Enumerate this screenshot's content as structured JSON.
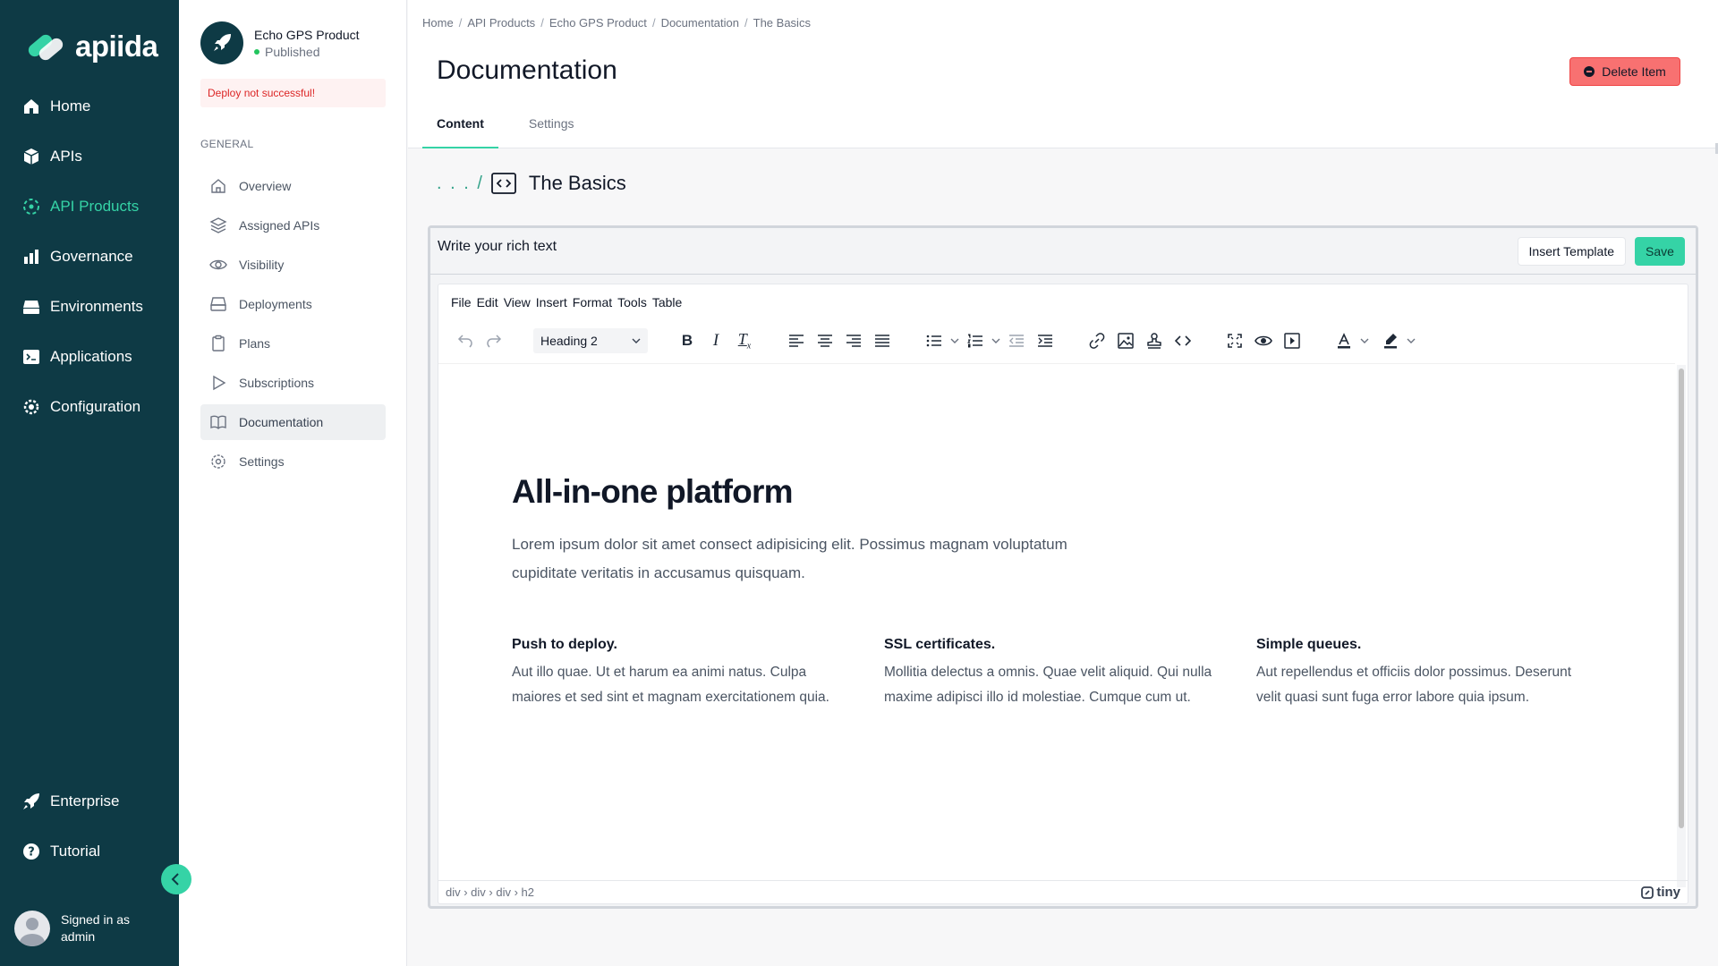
{
  "sidebar": {
    "brand": "apiida",
    "nav": [
      {
        "label": "Home",
        "icon": "home-icon"
      },
      {
        "label": "APIs",
        "icon": "cube-icon"
      },
      {
        "label": "API Products",
        "icon": "product-icon"
      },
      {
        "label": "Governance",
        "icon": "bar-chart-icon"
      },
      {
        "label": "Environments",
        "icon": "server-icon"
      },
      {
        "label": "Applications",
        "icon": "terminal-icon"
      },
      {
        "label": "Configuration",
        "icon": "gear-icon"
      }
    ],
    "bottom": [
      {
        "label": "Enterprise",
        "icon": "rocket-icon"
      },
      {
        "label": "Tutorial",
        "icon": "question-icon"
      }
    ],
    "user": {
      "line1": "Signed in as",
      "line2": "admin"
    },
    "accent": "#35d3a6",
    "background": "#0e3a45"
  },
  "product": {
    "name": "Echo GPS Product",
    "status": "Published",
    "alert": "Deploy not successful!"
  },
  "subnav": {
    "section": "GENERAL",
    "items": [
      {
        "label": "Overview",
        "icon": "home-outline-icon"
      },
      {
        "label": "Assigned APIs",
        "icon": "layers-icon"
      },
      {
        "label": "Visibility",
        "icon": "eye-icon"
      },
      {
        "label": "Deployments",
        "icon": "drive-icon"
      },
      {
        "label": "Plans",
        "icon": "clipboard-icon"
      },
      {
        "label": "Subscriptions",
        "icon": "play-icon"
      },
      {
        "label": "Documentation",
        "icon": "book-icon"
      },
      {
        "label": "Settings",
        "icon": "gear-outline-icon"
      }
    ]
  },
  "breadcrumb": [
    "Home",
    "API Products",
    "Echo GPS Product",
    "Documentation",
    "The Basics"
  ],
  "page": {
    "title": "Documentation",
    "delete_label": "Delete Item",
    "tabs": [
      "Content",
      "Settings"
    ],
    "path_prefix": ". . . /",
    "doc_title": "The Basics"
  },
  "editor": {
    "label": "Write your rich text",
    "insert_template": "Insert Template",
    "save": "Save",
    "menu": [
      "File",
      "Edit",
      "View",
      "Insert",
      "Format",
      "Tools",
      "Table"
    ],
    "block_format": "Heading 2",
    "heading": "All-in-one platform",
    "intro": "Lorem ipsum dolor sit amet consect adipisicing elit. Possimus magnam voluptatum cupiditate veritatis in accusamus quisquam.",
    "features": [
      {
        "title": "Push to deploy.",
        "text": "Aut illo quae. Ut et harum ea animi natus. Culpa maiores et sed sint et magnam exercitationem quia."
      },
      {
        "title": "SSL certificates.",
        "text": "Mollitia delectus a omnis. Quae velit aliquid. Qui nulla maxime adipisci illo id molestiae. Cumque cum ut."
      },
      {
        "title": "Simple queues.",
        "text": "Aut repellendus et officiis dolor possimus. Deserunt velit quasi sunt fuga error labore quia ipsum."
      }
    ],
    "element_path": "div › div › div › h2",
    "brand": "tiny"
  }
}
